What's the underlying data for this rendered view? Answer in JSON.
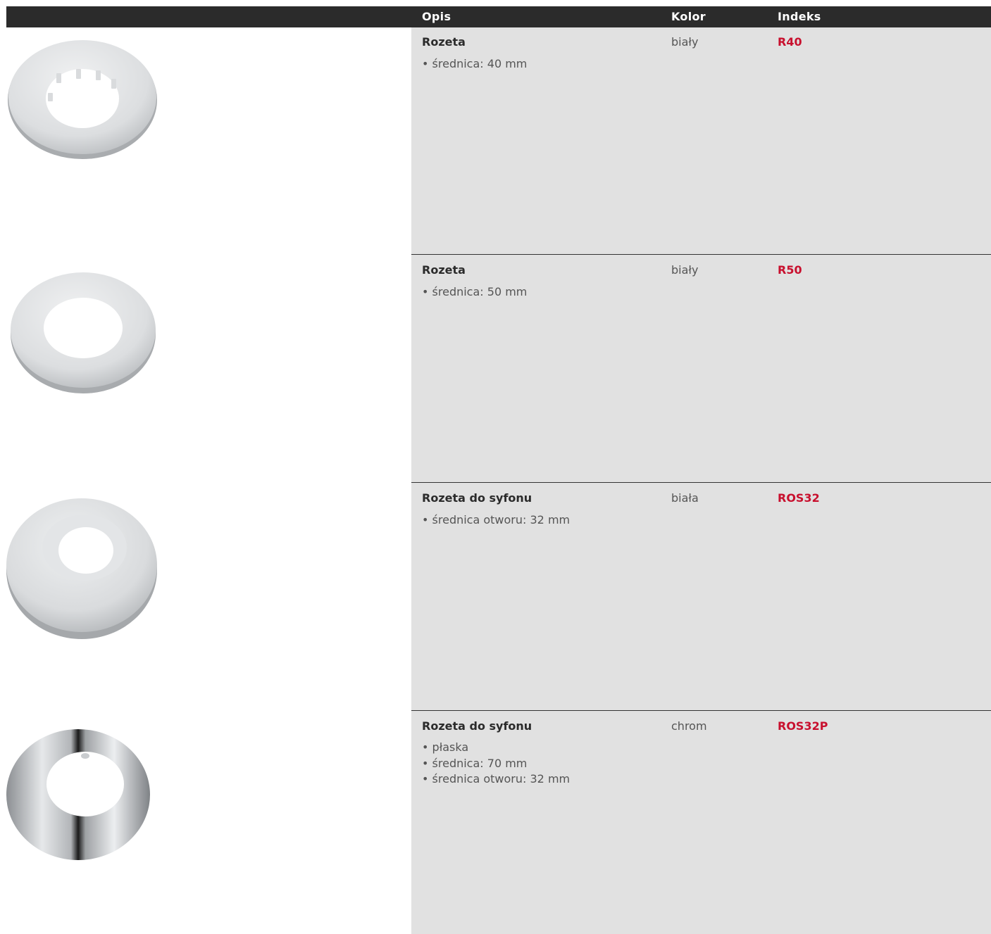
{
  "header": {
    "col_desc": "Opis",
    "col_color": "Kolor",
    "col_index": "Indeks"
  },
  "colors": {
    "header_bg": "#2b2b2b",
    "panel_bg": "#e1e1e1",
    "index_red": "#c8102e"
  },
  "products": [
    {
      "name": "Rozeta",
      "bullets": [
        "średnica: 40 mm"
      ],
      "color": "biały",
      "index": "R40",
      "image": "white-rosette-notched-icon"
    },
    {
      "name": "Rozeta",
      "bullets": [
        "średnica: 50 mm"
      ],
      "color": "biały",
      "index": "R50",
      "image": "white-rosette-icon"
    },
    {
      "name": "Rozeta do syfonu",
      "bullets": [
        "średnica otworu: 32 mm"
      ],
      "color": "biała",
      "index": "ROS32",
      "image": "white-siphon-rosette-icon"
    },
    {
      "name": "Rozeta do syfonu",
      "bullets": [
        "płaska",
        "średnica: 70 mm",
        "średnica otworu: 32 mm"
      ],
      "color": "chrom",
      "index": "ROS32P",
      "image": "chrome-flat-rosette-icon"
    }
  ]
}
